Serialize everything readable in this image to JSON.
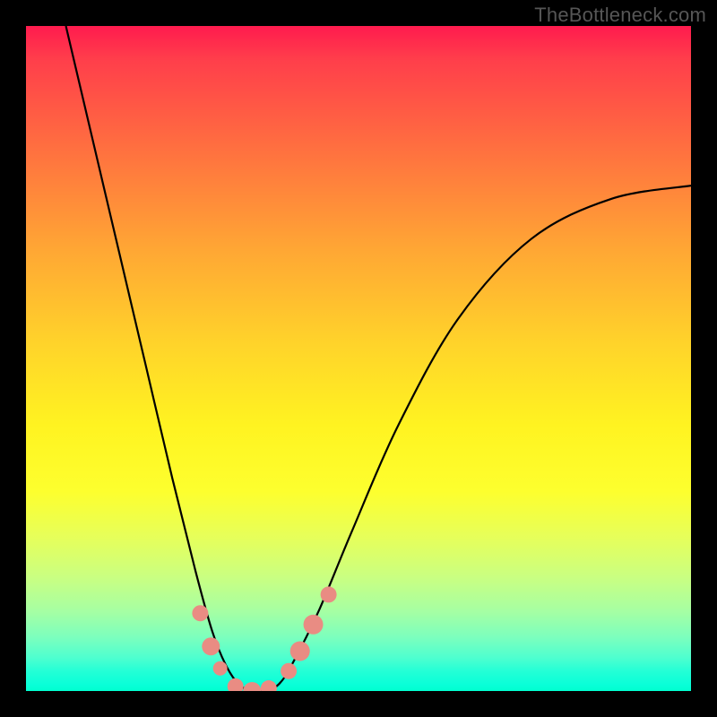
{
  "watermark": "TheBottleneck.com",
  "chart_data": {
    "type": "line",
    "title": "",
    "xlabel": "",
    "ylabel": "",
    "xlim": [
      0,
      1
    ],
    "ylim": [
      0,
      1
    ],
    "series": [
      {
        "name": "bottleneck-curve",
        "x": [
          0.06,
          0.1,
          0.14,
          0.18,
          0.22,
          0.255,
          0.28,
          0.3,
          0.32,
          0.34,
          0.36,
          0.38,
          0.4,
          0.44,
          0.49,
          0.56,
          0.65,
          0.76,
          0.88,
          1.0
        ],
        "y": [
          1.0,
          0.83,
          0.66,
          0.49,
          0.32,
          0.18,
          0.09,
          0.04,
          0.01,
          0.0,
          0.0,
          0.01,
          0.04,
          0.12,
          0.24,
          0.4,
          0.56,
          0.68,
          0.74,
          0.76
        ]
      }
    ],
    "markers": [
      {
        "name": "left-dot-1",
        "x": 0.262,
        "y": 0.117,
        "r": 9
      },
      {
        "name": "left-dot-2",
        "x": 0.278,
        "y": 0.067,
        "r": 10
      },
      {
        "name": "left-dot-3",
        "x": 0.292,
        "y": 0.034,
        "r": 8
      },
      {
        "name": "floor-1",
        "x": 0.315,
        "y": 0.007,
        "r": 9
      },
      {
        "name": "floor-2",
        "x": 0.34,
        "y": 0.0,
        "r": 10
      },
      {
        "name": "floor-3",
        "x": 0.365,
        "y": 0.004,
        "r": 9
      },
      {
        "name": "right-dot-1",
        "x": 0.395,
        "y": 0.03,
        "r": 9
      },
      {
        "name": "right-dot-2",
        "x": 0.412,
        "y": 0.06,
        "r": 11
      },
      {
        "name": "right-dot-3",
        "x": 0.432,
        "y": 0.1,
        "r": 11
      },
      {
        "name": "right-dot-4",
        "x": 0.455,
        "y": 0.145,
        "r": 9
      }
    ],
    "marker_color": "#e98c83",
    "curve_color": "#000000",
    "curve_width": 2.2
  }
}
